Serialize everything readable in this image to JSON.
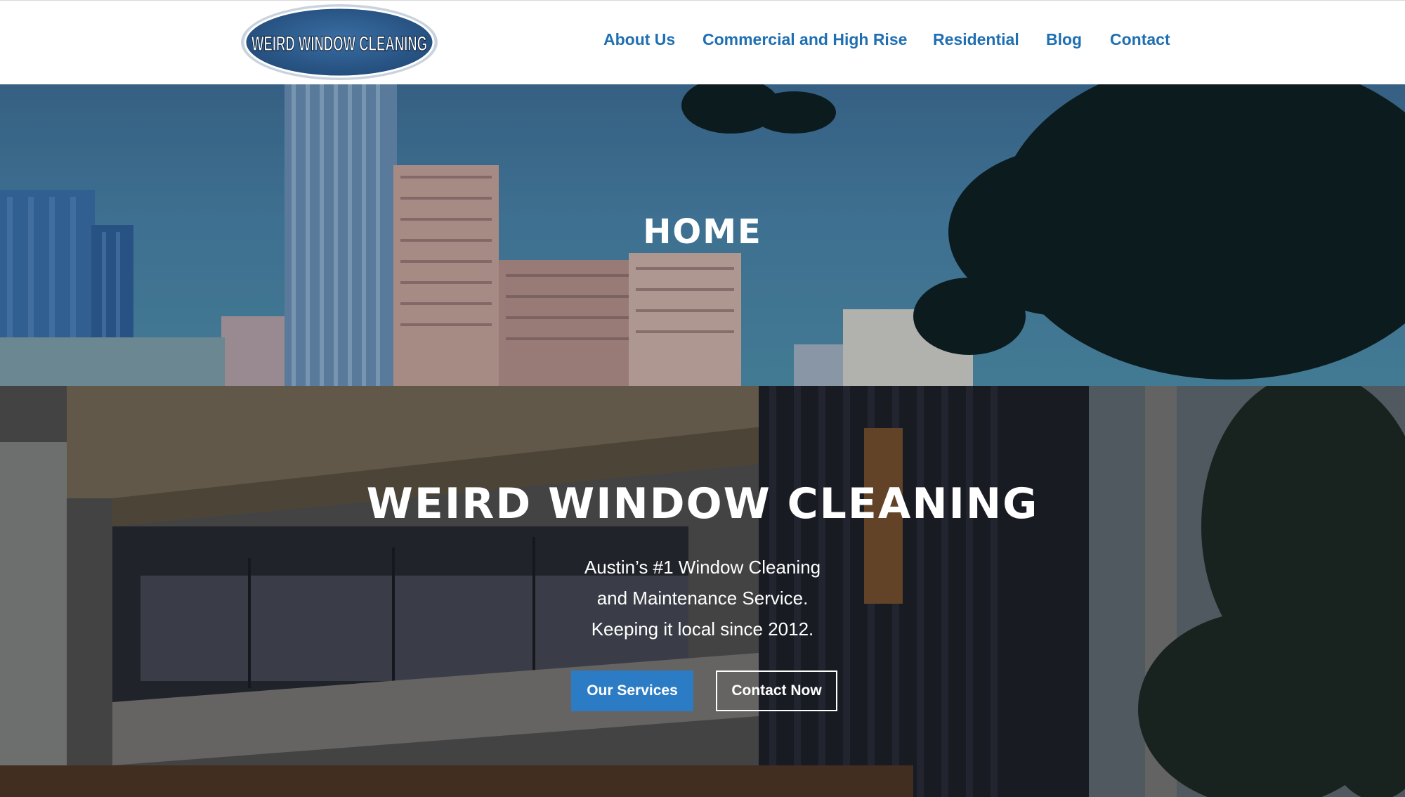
{
  "header": {
    "logo_text": "WEIRD WINDOW CLEANING",
    "nav": [
      {
        "label": "About Us"
      },
      {
        "label": "Commercial and High Rise"
      },
      {
        "label": "Residential"
      },
      {
        "label": "Blog"
      },
      {
        "label": "Contact"
      }
    ]
  },
  "page_banner": {
    "title": "HOME"
  },
  "hero": {
    "title": "WEIRD WINDOW CLEANING",
    "lines": [
      "Austin’s #1 Window Cleaning",
      "and Maintenance Service.",
      "Keeping it local since 2012."
    ],
    "primary_button": "Our Services",
    "secondary_button": "Contact Now"
  },
  "colors": {
    "nav_link": "#1f6fb3",
    "primary_button": "#2b7cc4",
    "logo_fill": "#2c5a8c"
  }
}
